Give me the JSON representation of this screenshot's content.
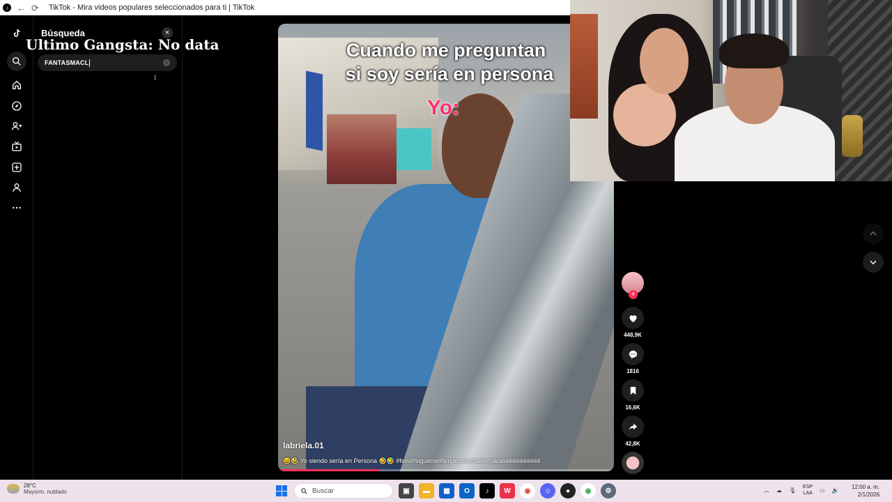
{
  "browser": {
    "title": "TikTok - Mira videos populares seleccionados para ti | TikTok"
  },
  "search_panel": {
    "title": "Búsqueda",
    "query": "FANTASMACL",
    "close_glyph": "×"
  },
  "overlay": {
    "text": "Ultimo Gangsta: No data"
  },
  "rail": {
    "icons": [
      "tiktok-logo-icon",
      "search-icon",
      "home-icon",
      "explore-icon",
      "following-icon",
      "live-icon",
      "upload-icon",
      "profile-icon",
      "more-icon"
    ]
  },
  "video": {
    "caption_line1": "Cuando me preguntan",
    "caption_line2": "si soy sería en persona",
    "caption_yo": "Yo:",
    "author": "labriela.01",
    "description": "😆🤣 Yo siendo sería en Persona 🤣🤣 #feed#sigueme#tendencia#baile#paratiiiiiiiiiiiiiiiiiiiiiiiiii",
    "progress": 0.3
  },
  "actions": {
    "likes": "448,9K",
    "comments": "1816",
    "saves": "16,6K",
    "shares": "42,8K"
  },
  "taskbar": {
    "weather_temp": "28°C",
    "weather_desc": "Mayorm. nublado",
    "search_placeholder": "Buscar",
    "lang_top": "ESP",
    "lang_bottom": "LAA",
    "time": "12:00 a. m.",
    "date": "2/1/2026"
  },
  "colors": {
    "accent": "#ff2f56",
    "taskbar_bg": "#eee2ec"
  }
}
